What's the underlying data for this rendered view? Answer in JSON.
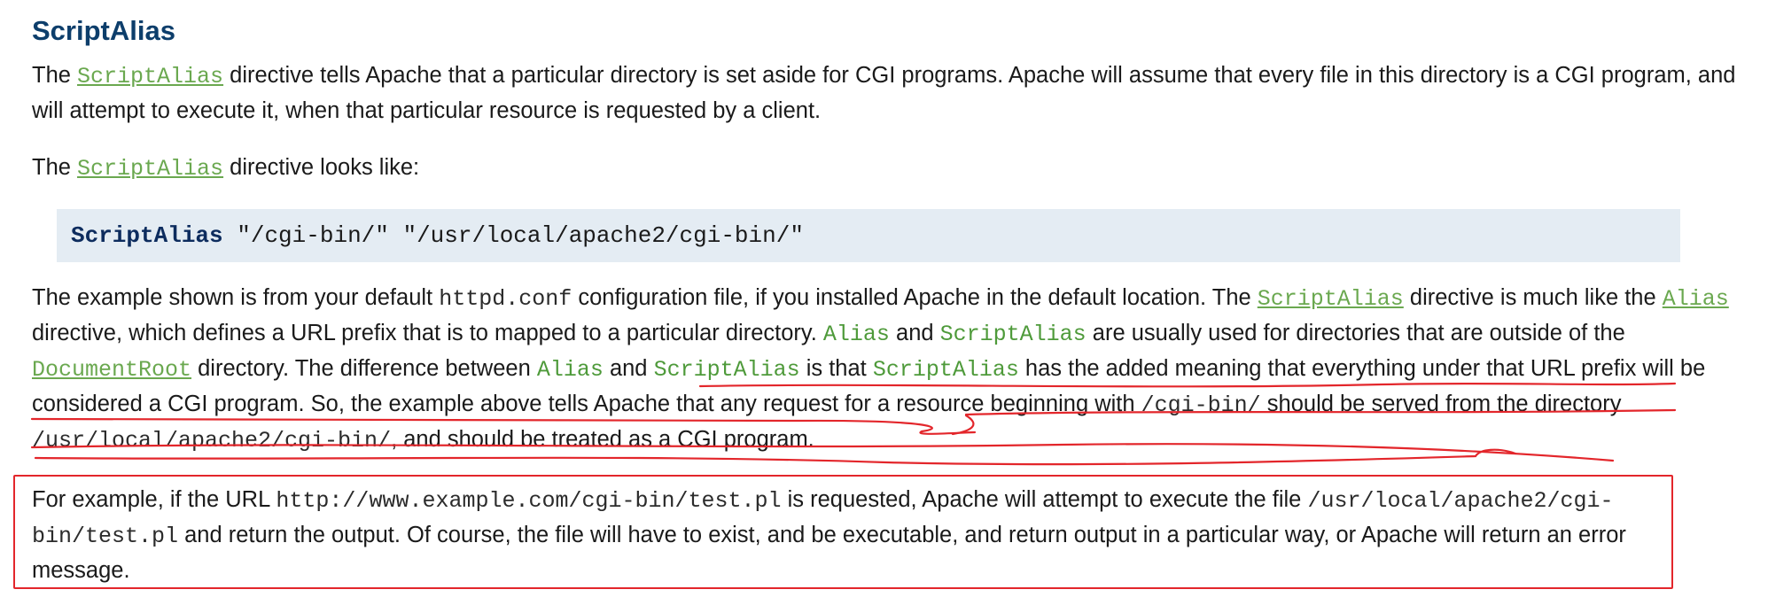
{
  "heading": "ScriptAlias",
  "p1": {
    "t1": "The ",
    "link": "ScriptAlias",
    "t2": " directive tells Apache that a particular directory is set aside for CGI programs. Apache will assume that every file in this directory is a CGI program, and will attempt to execute it, when that particular resource is requested by a client."
  },
  "p2": {
    "t1": "The ",
    "link": "ScriptAlias",
    "t2": " directive looks like:"
  },
  "code_block": {
    "keyword": "ScriptAlias",
    "args": " \"/cgi-bin/\" \"/usr/local/apache2/cgi-bin/\""
  },
  "p3": {
    "t1": "The example shown is from your default ",
    "c1": "httpd.conf",
    "t2": " configuration file, if you installed Apache in the default location. The ",
    "link1": "ScriptAlias",
    "t3": " directive is much like the ",
    "link2": "Alias",
    "t4": " directive, which defines a URL prefix that is to mapped to a particular directory. ",
    "c2": "Alias",
    "t5": " and ",
    "c3": "ScriptAlias",
    "t6": " are usually used for directories that are outside of the ",
    "link3": "DocumentRoot",
    "t7": " directory. The difference between ",
    "c4": "Alias",
    "t8": " and ",
    "c5": "ScriptAlias",
    "t9": " is that ",
    "c6": "ScriptAlias",
    "t10": " has the added meaning that everything under that URL prefix will be considered a CGI program. So, the example above tells Apache that any request for a resource beginning with ",
    "c7": "/cgi-bin/",
    "t11": " should be served from the directory ",
    "c8": "/usr/local/apache2/cgi-bin/",
    "t12": ", and should be treated as a CGI program."
  },
  "p4": {
    "t1": "For example, if the URL ",
    "c1": "http://www.example.com/cgi-bin/test.pl",
    "t2": " is requested, Apache will attempt to execute the file ",
    "c2": "/usr/local/apache2/cgi-bin/test.pl",
    "t3": " and return the output. Of course, the file will have to exist, and be executable, and return output in a particular way, or Apache will return an error message."
  },
  "colors": {
    "heading": "#0d3e6b",
    "link": "#6aa84f",
    "code_bg": "#e4ecf3",
    "annotation": "#e3262b"
  }
}
